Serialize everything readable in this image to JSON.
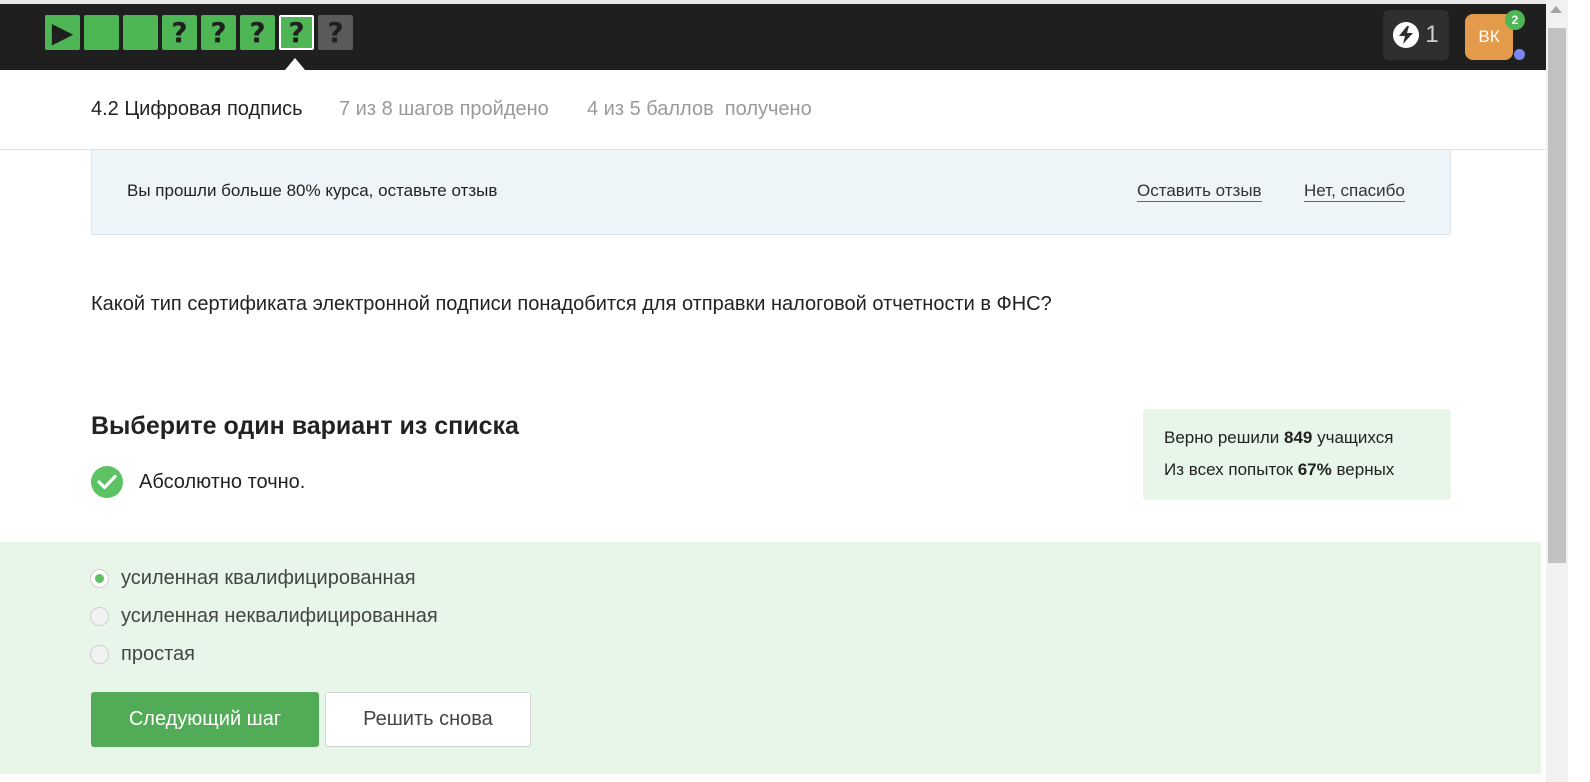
{
  "topbar": {
    "steps": [
      {
        "glyph": "▶",
        "state": "passed"
      },
      {
        "glyph": "",
        "state": "passed"
      },
      {
        "glyph": "",
        "state": "passed"
      },
      {
        "glyph": "?",
        "state": "passed"
      },
      {
        "glyph": "?",
        "state": "passed"
      },
      {
        "glyph": "?",
        "state": "passed"
      },
      {
        "glyph": "?",
        "state": "current"
      },
      {
        "glyph": "?",
        "state": "locked"
      }
    ],
    "energy": {
      "icon": "lightning-icon",
      "count": "1"
    },
    "avatar": {
      "initials": "ВК",
      "notifications": "2"
    }
  },
  "lesson": {
    "title": "4.2 Цифровая подпись",
    "progress": "7 из 8 шагов пройдено",
    "score": "4 из 5 баллов  получено"
  },
  "review_banner": {
    "text": "Вы прошли больше 80% курса, оставьте отзыв",
    "leave_review": "Оставить отзыв",
    "decline": "Нет, спасибо"
  },
  "question": {
    "text": "Какой тип сертификата электронной подписи понадобится для отправки налоговой отчетности в ФНС?"
  },
  "quiz": {
    "title": "Выберите один вариант из списка",
    "result": "Абсолютно точно.",
    "options": [
      {
        "label": "усиленная квалифицированная",
        "selected": true
      },
      {
        "label": "усиленная неквалифицированная",
        "selected": false
      },
      {
        "label": "простая",
        "selected": false
      }
    ],
    "next_button": "Следующий шаг",
    "retry_button": "Решить снова"
  },
  "stats": {
    "solved_prefix": "Верно решили ",
    "solved_count": "849",
    "solved_suffix": " учащихся",
    "attempts_prefix": "Из всех попыток ",
    "attempts_percent": "67%",
    "attempts_suffix": " верных"
  },
  "colors": {
    "accent_green": "#4eb654",
    "topbar": "#1f1f1f",
    "success_bg": "#e7f6e8",
    "banner_bg": "#eef5f8"
  }
}
